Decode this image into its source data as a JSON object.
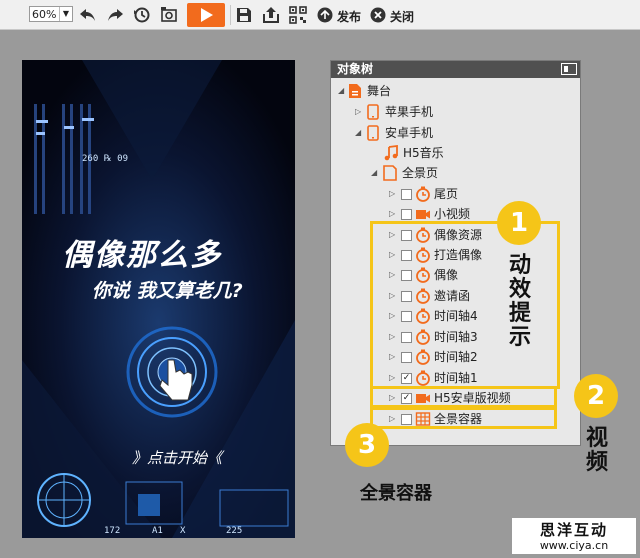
{
  "toolbar": {
    "zoom_value": "60%",
    "publish_label": "发布",
    "close_label": "关闭"
  },
  "canvas": {
    "title_main": "偶像那么多",
    "title_sub": "你说 我又算老几?",
    "start_text": "》点击开始《",
    "hud_number": "260 ℞ 09",
    "hud_bottom_left": "172",
    "hud_bottom_mid": "A1",
    "hud_bottom_x": "X",
    "hud_bottom_right": "225"
  },
  "panel": {
    "title": "对象树",
    "items": [
      {
        "label": "舞台"
      },
      {
        "label": "苹果手机"
      },
      {
        "label": "安卓手机"
      },
      {
        "label": "H5音乐"
      },
      {
        "label": "全景页"
      },
      {
        "label": "尾页"
      },
      {
        "label": "小视频"
      },
      {
        "label": "偶像资源"
      },
      {
        "label": "打造偶像"
      },
      {
        "label": "偶像"
      },
      {
        "label": "邀请函"
      },
      {
        "label": "时间轴4"
      },
      {
        "label": "时间轴3"
      },
      {
        "label": "时间轴2"
      },
      {
        "label": "时间轴1"
      },
      {
        "label": "H5安卓版视频"
      },
      {
        "label": "全景容器"
      }
    ]
  },
  "annotations": {
    "badge1": "1",
    "badge2": "2",
    "badge3": "3",
    "text1": "动效提示",
    "text2": "视频",
    "text3": "全景容器"
  },
  "watermark": {
    "title": "思洋互动",
    "url": "www.ciya.cn"
  },
  "colors": {
    "accent": "#f26b1d",
    "annotation": "#f5c518",
    "panel_header": "#505050"
  }
}
